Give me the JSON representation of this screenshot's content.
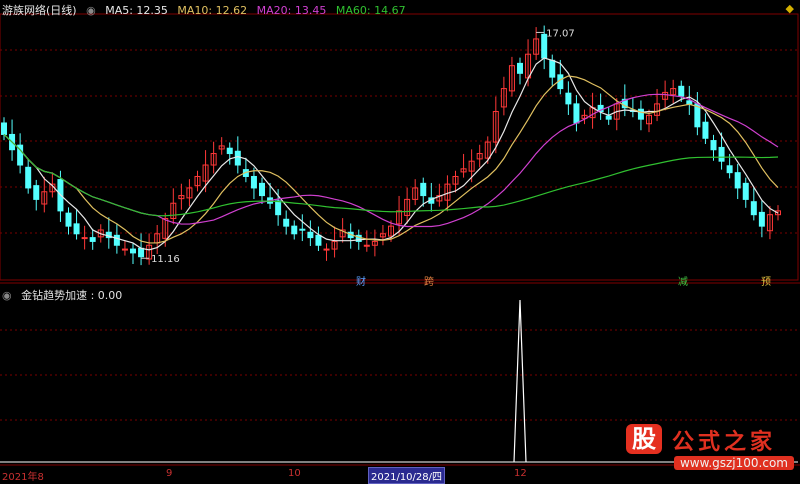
{
  "header": {
    "stock_name": "游族网络(日线)",
    "ma5": "MA5: 12.35",
    "ma10": "MA10: 12.62",
    "ma20": "MA20: 13.45",
    "ma60": "MA60: 14.67"
  },
  "indicator": {
    "label": "金钻趋势加速 : 0.00"
  },
  "tags": [
    "财",
    "跨",
    "减",
    "预"
  ],
  "x_axis": {
    "labels": [
      "2021年8",
      "9",
      "10",
      "12"
    ],
    "selected": "2021/10/28/四"
  },
  "watermark": {
    "badge": "股",
    "name": "公式之家",
    "url": "www.gszj100.com"
  },
  "colors": {
    "up": "#ff3838",
    "down": "#54ffff",
    "ma5": "#e8e8e8",
    "ma10": "#e0c060",
    "ma20": "#d040d0",
    "ma60": "#30c030",
    "grid": "#7a0000"
  },
  "chart_data": {
    "type": "candlestick",
    "price_annotations": {
      "high": 17.07,
      "low": 11.16
    },
    "ma_values": {
      "MA5": 12.35,
      "MA10": 12.62,
      "MA20": 13.45,
      "MA60": 14.67
    },
    "close": [
      14.4,
      14.0,
      13.6,
      13.0,
      12.7,
      12.9,
      13.1,
      12.4,
      12.0,
      11.8,
      11.7,
      11.6,
      11.9,
      11.7,
      11.5,
      11.4,
      11.3,
      11.2,
      11.5,
      11.8,
      12.2,
      12.6,
      12.8,
      13.0,
      13.3,
      13.6,
      13.9,
      14.1,
      13.9,
      13.6,
      13.3,
      13.0,
      12.8,
      12.6,
      12.3,
      12.0,
      11.8,
      11.9,
      11.7,
      11.5,
      11.4,
      11.6,
      11.9,
      11.7,
      11.6,
      11.5,
      11.6,
      11.8,
      12.0,
      12.4,
      12.7,
      13.0,
      12.8,
      12.6,
      12.8,
      13.1,
      13.3,
      13.5,
      13.7,
      13.9,
      14.2,
      15.0,
      15.6,
      16.2,
      16.0,
      16.5,
      16.9,
      16.4,
      15.9,
      15.6,
      15.2,
      14.7,
      14.9,
      15.1,
      15.0,
      14.8,
      15.2,
      15.1,
      15.0,
      14.8,
      14.9,
      15.2,
      15.5,
      15.6,
      15.4,
      15.2,
      14.6,
      14.3,
      14.0,
      13.7,
      13.4,
      13.0,
      12.7,
      12.3,
      12.0,
      12.3,
      12.4
    ],
    "indicator_series": {
      "name": "金钻趋势加速",
      "current": 0.0,
      "peak_index": 64
    }
  }
}
